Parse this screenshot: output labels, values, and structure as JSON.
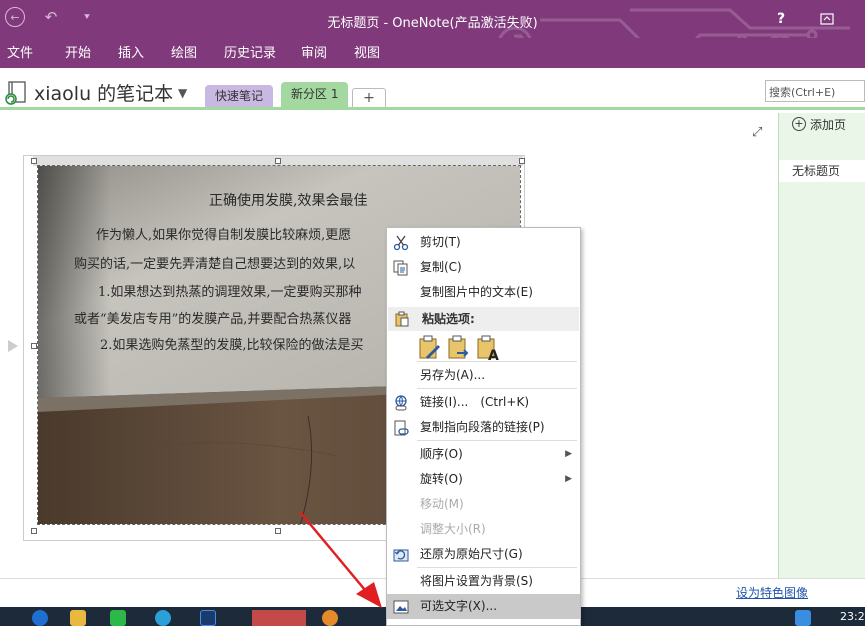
{
  "window": {
    "title": "无标题页 - OneNote(产品激活失败)",
    "help_label": "?"
  },
  "ribbon": {
    "tabs": [
      "文件",
      "开始",
      "插入",
      "绘图",
      "历史记录",
      "审阅",
      "视图"
    ]
  },
  "notebook": {
    "name": "xiaolu 的笔记本",
    "sections": [
      {
        "label": "快速笔记",
        "color": "#c9b8e2"
      },
      {
        "label": "新分区 1",
        "color": "#a3d8a0"
      }
    ],
    "add_section_label": "+",
    "search_placeholder": "搜索(Ctrl+E)"
  },
  "page_pane": {
    "add_page_label": "添加页",
    "pages": [
      "无标题页"
    ]
  },
  "photo_text": {
    "heading": "正确使用发膜,效果会最佳",
    "lines": [
      "作为懒人,如果你觉得自制发膜比较麻烦,更愿",
      "购买的话,一定要先弄清楚自己想要达到的效果,以",
      "1.如果想达到热蒸的调理效果,一定要购买那种",
      "或者“美发店专用”的发膜产品,并要配合热蒸仪器",
      "2.如果选购免蒸型的发膜,比较保险的做法是买"
    ]
  },
  "context_menu": {
    "items": [
      {
        "label": "剪切(T)",
        "icon": "scissors-icon",
        "enabled": true
      },
      {
        "label": "复制(C)",
        "icon": "copy-icon",
        "enabled": true
      },
      {
        "label": "复制图片中的文本(E)",
        "enabled": true
      },
      {
        "label": "另存为(A)...",
        "enabled": true
      },
      {
        "label": "链接(I)...",
        "shortcut": "(Ctrl+K)",
        "icon": "link-icon",
        "enabled": true
      },
      {
        "label": "复制指向段落的链接(P)",
        "icon": "copy-link-icon",
        "enabled": true
      },
      {
        "label": "顺序(O)",
        "submenu": true,
        "enabled": true
      },
      {
        "label": "旋转(O)",
        "submenu": true,
        "enabled": true
      },
      {
        "label": "移动(M)",
        "enabled": false
      },
      {
        "label": "调整大小(R)",
        "enabled": false
      },
      {
        "label": "还原为原始尺寸(G)",
        "icon": "restore-size-icon",
        "enabled": true
      },
      {
        "label": "将图片设置为背景(S)",
        "enabled": true
      },
      {
        "label": "可选文字(X)...",
        "icon": "alt-text-icon",
        "enabled": true,
        "highlighted": true
      }
    ],
    "paste_header": "粘贴选项:"
  },
  "bottom": {
    "link_label": "设为特色图像"
  },
  "taskbar": {
    "clock": "23:2"
  }
}
